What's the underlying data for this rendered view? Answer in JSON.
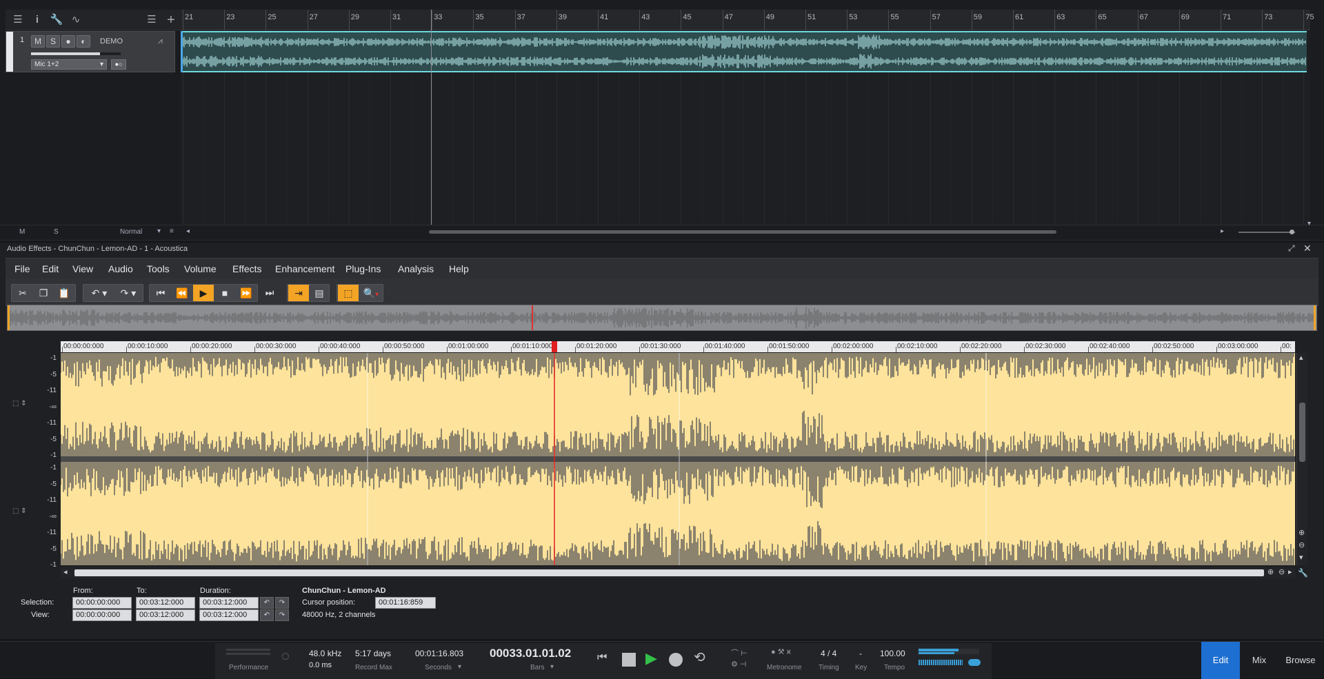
{
  "arrange": {
    "bars": [
      "21",
      "23",
      "25",
      "27",
      "29",
      "31",
      "33",
      "35",
      "37",
      "39",
      "41",
      "43",
      "45",
      "47",
      "49",
      "51",
      "53",
      "55",
      "57",
      "59",
      "61",
      "63",
      "65",
      "67",
      "69",
      "71",
      "73",
      "75"
    ],
    "track": {
      "number": "1",
      "mute": "M",
      "solo": "S",
      "name": "DEMO",
      "input": "Mic 1+2"
    },
    "bottom": {
      "m": "M",
      "s": "S",
      "mode": "Normal"
    },
    "colors": {
      "clip_border": "#6ddcdf",
      "clip_fill": "#2e4b4e"
    }
  },
  "panel": {
    "title": "Audio Effects - ChunChun - Lemon-AD - 1 - Acoustica",
    "menus": [
      "File",
      "Edit",
      "View",
      "Audio",
      "Tools",
      "Volume",
      "Effects",
      "Enhancement",
      "Plug-Ins",
      "Analysis",
      "Help"
    ],
    "timeline": [
      "00:00:00:000",
      "00:00:10:000",
      "00:00:20:000",
      "00:00:30:000",
      "00:00:40:000",
      "00:00:50:000",
      "00:01:00:000",
      "00:01:10:000",
      "00:01:20:000",
      "00:01:30:000",
      "00:01:40:000",
      "00:01:50:000",
      "00:02:00:000",
      "00:02:10:000",
      "00:02:20:000",
      "00:02:30:000",
      "00:02:40:000",
      "00:02:50:000",
      "00:03:00:000",
      "00:"
    ],
    "db_labels_ch1": [
      "-1",
      "-5",
      "-11",
      "-∞",
      "-11",
      "-5",
      "-1"
    ],
    "db_labels_ch2": [
      "-1",
      "-5",
      "-11",
      "-∞",
      "-11",
      "-5",
      "-1"
    ],
    "colors": {
      "waveform_bg": "#fde39b",
      "waveform_fg": "#5a5a5a",
      "cursor": "#e02020",
      "accent": "#f3a425"
    },
    "info": {
      "from_label": "From:",
      "to_label": "To:",
      "duration_label": "Duration:",
      "selection_label": "Selection:",
      "view_label": "View:",
      "selection": {
        "from": "00:00:00:000",
        "to": "00:03:12:000",
        "duration": "00:03:12:000"
      },
      "view": {
        "from": "00:00:00:000",
        "to": "00:03:12:000",
        "duration": "00:03:12:000"
      },
      "file_name": "ChunChun - Lemon-AD",
      "cursor_label": "Cursor position:",
      "cursor_value": "00:01:16:859",
      "format": "48000 Hz, 2 channels"
    }
  },
  "transport": {
    "performance_label": "Performance",
    "sample_rate": "48.0 kHz",
    "latency": "0.0 ms",
    "record_max_value": "5:17 days",
    "record_max_label": "Record Max",
    "seconds_value": "00:01:16.803",
    "seconds_label": "Seconds",
    "bars_value": "00033.01.01.02",
    "bars_label": "Bars",
    "metronome_label": "Metronome",
    "timing_value": "4 / 4",
    "timing_label": "Timing",
    "key_value": "-",
    "key_label": "Key",
    "tempo_value": "100.00",
    "tempo_label": "Tempo",
    "nav": {
      "edit": "Edit",
      "mix": "Mix",
      "browse": "Browse"
    },
    "colors": {
      "edit_active": "#1d6fd1",
      "play": "#33c14a"
    }
  }
}
